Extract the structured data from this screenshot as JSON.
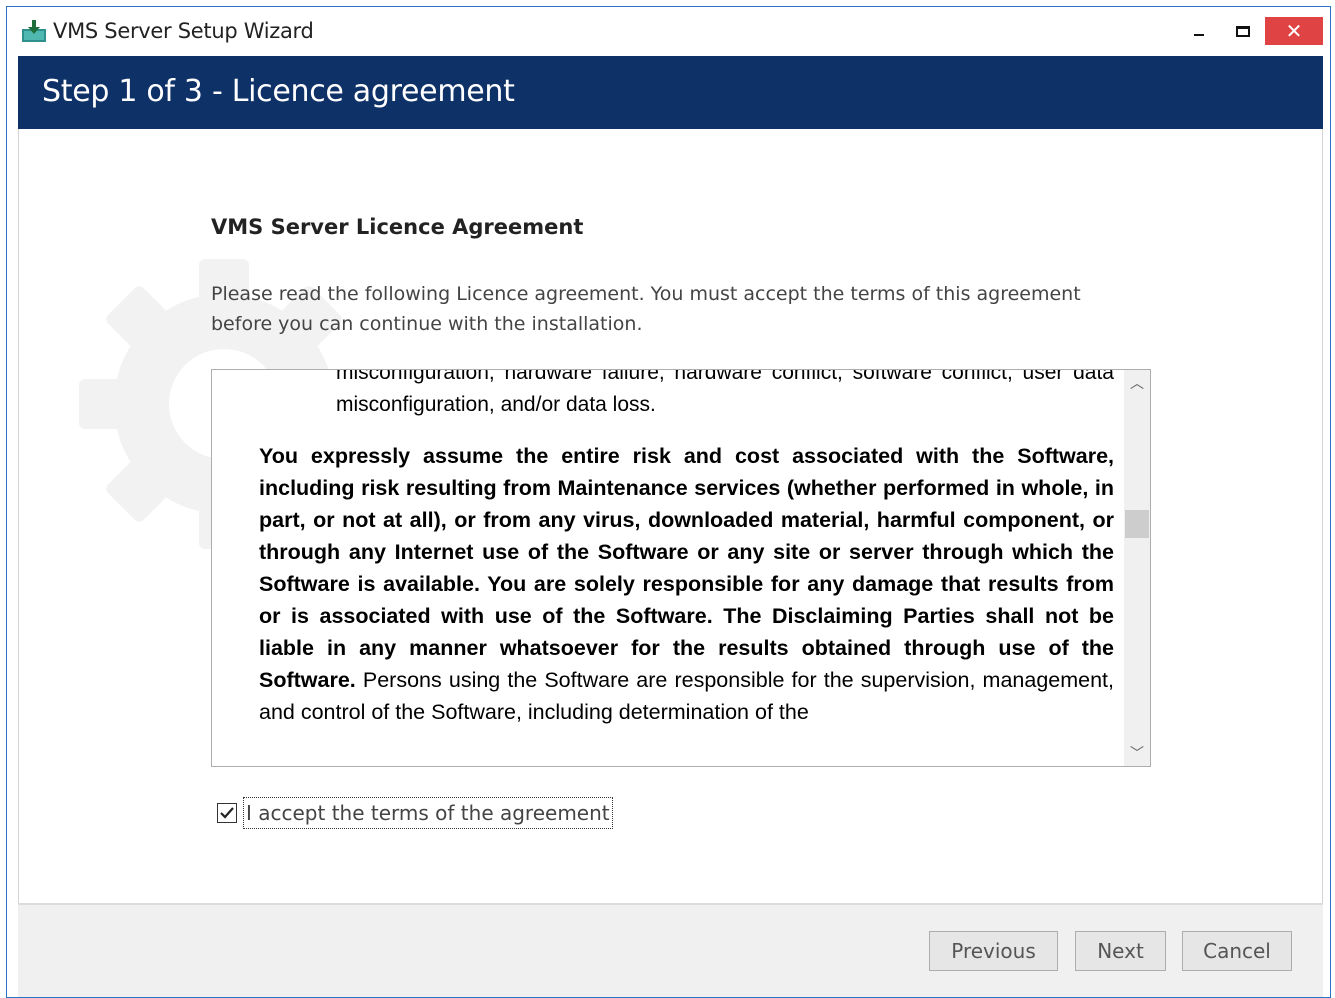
{
  "window": {
    "title": "VMS Server Setup Wizard",
    "close_glyph": "✕"
  },
  "header": {
    "title": "Step 1 of 3 - Licence agreement"
  },
  "content": {
    "section_title": "VMS Server Licence Agreement",
    "intro": "Please read the following Licence agreement. You must accept the terms of this agreement before you can continue with the installation.",
    "license": {
      "p1": "misconfiguration, hardware failure, hardware conflict, software conflict, user data misconfiguration, and/or data loss.",
      "p2_bold": "You expressly assume the entire risk and cost associated with the Software, including risk resulting from Maintenance services (whether performed in whole, in part, or not at all), or from any virus, downloaded material, harmful component, or through any Internet use of the Software or any site or server through which the Software is available. You are solely responsible for any damage that results from or is associated with use of the Software. The Disclaiming Parties shall not be liable in any manner whatsoever for the results obtained through use of the Software.",
      "p2_normal": " Persons using the Software are responsible for the supervision, management, and control of the Software, including determination of the"
    },
    "scroll_up_glyph": "︿",
    "scroll_down_glyph": "﹀",
    "accept_checked": true,
    "accept_label": "I accept the terms of the agreement"
  },
  "footer": {
    "previous_label": "Previous",
    "next_label": "Next",
    "cancel_label": "Cancel"
  },
  "colors": {
    "header_bg": "#0e3167",
    "close_bg": "#e04343",
    "window_border": "#2b73c9"
  }
}
